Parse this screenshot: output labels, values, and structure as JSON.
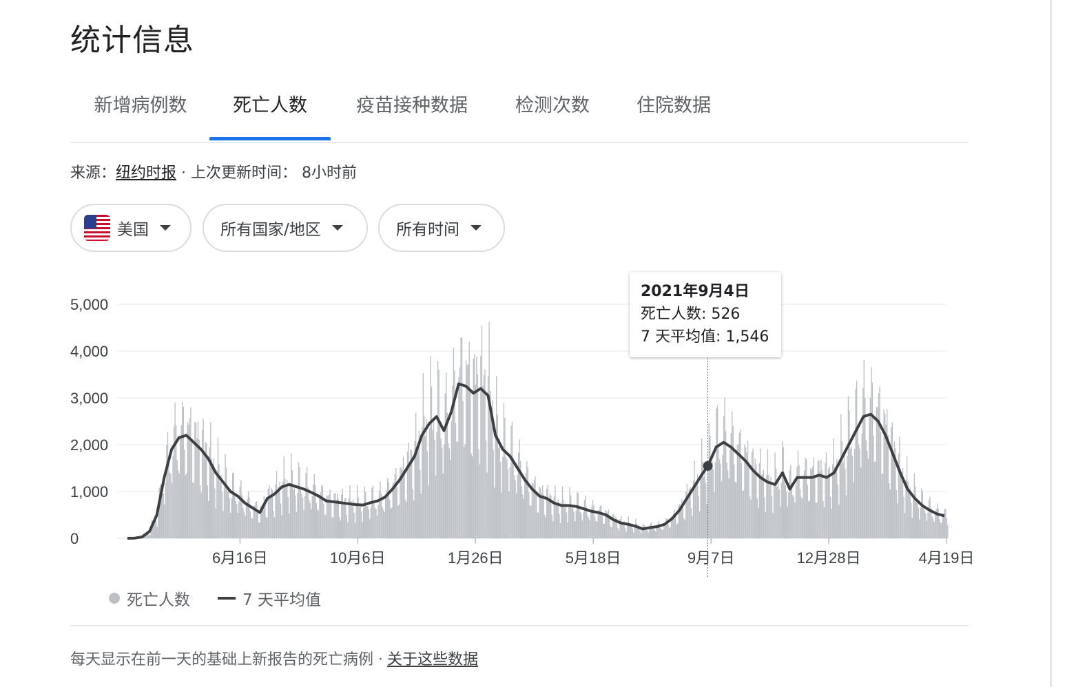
{
  "page": {
    "title": "统计信息"
  },
  "tabs": [
    {
      "label": "新增病例数",
      "active": false
    },
    {
      "label": "死亡人数",
      "active": true
    },
    {
      "label": "疫苗接种数据",
      "active": false
    },
    {
      "label": "检测次数",
      "active": false
    },
    {
      "label": "住院数据",
      "active": false
    }
  ],
  "source": {
    "prefix": "来源：",
    "name": "纽约时报",
    "sep": " · 上次更新时间： ",
    "updated": "8小时前"
  },
  "filters": {
    "country": "美国",
    "region": "所有国家/地区",
    "time": "所有时间"
  },
  "chart_data": {
    "type": "bar",
    "combo_line": true,
    "y_ticks": [
      "5,000",
      "4,000",
      "3,000",
      "2,000",
      "1,000",
      "0"
    ],
    "ylim": [
      0,
      5000
    ],
    "x_ticks": [
      "6月16日",
      "10月6日",
      "1月26日",
      "5月18日",
      "9月7日",
      "12月28日",
      "4月19日"
    ],
    "grid": true,
    "colors": {
      "bars": "#bdc1c6",
      "line": "#3c4043",
      "accent": "#1a73e8"
    },
    "series": [
      {
        "name": "死亡人数",
        "kind": "daily_bars"
      },
      {
        "name": "7 天平均值",
        "kind": "line"
      }
    ],
    "weekly_avg": [
      {
        "x": "2020-03-01",
        "y": 0
      },
      {
        "x": "2020-03-08",
        "y": 5
      },
      {
        "x": "2020-03-15",
        "y": 30
      },
      {
        "x": "2020-03-22",
        "y": 150
      },
      {
        "x": "2020-03-29",
        "y": 500
      },
      {
        "x": "2020-04-05",
        "y": 1300
      },
      {
        "x": "2020-04-12",
        "y": 1900
      },
      {
        "x": "2020-04-19",
        "y": 2150
      },
      {
        "x": "2020-04-26",
        "y": 2200
      },
      {
        "x": "2020-05-03",
        "y": 2050
      },
      {
        "x": "2020-05-10",
        "y": 1900
      },
      {
        "x": "2020-05-17",
        "y": 1700
      },
      {
        "x": "2020-05-24",
        "y": 1400
      },
      {
        "x": "2020-05-31",
        "y": 1200
      },
      {
        "x": "2020-06-07",
        "y": 1000
      },
      {
        "x": "2020-06-14",
        "y": 900
      },
      {
        "x": "2020-06-21",
        "y": 750
      },
      {
        "x": "2020-06-28",
        "y": 650
      },
      {
        "x": "2020-07-05",
        "y": 550
      },
      {
        "x": "2020-07-12",
        "y": 850
      },
      {
        "x": "2020-07-19",
        "y": 950
      },
      {
        "x": "2020-07-26",
        "y": 1100
      },
      {
        "x": "2020-08-02",
        "y": 1150
      },
      {
        "x": "2020-08-09",
        "y": 1100
      },
      {
        "x": "2020-08-16",
        "y": 1050
      },
      {
        "x": "2020-08-23",
        "y": 980
      },
      {
        "x": "2020-08-30",
        "y": 900
      },
      {
        "x": "2020-09-06",
        "y": 800
      },
      {
        "x": "2020-09-13",
        "y": 780
      },
      {
        "x": "2020-09-20",
        "y": 760
      },
      {
        "x": "2020-09-27",
        "y": 740
      },
      {
        "x": "2020-10-04",
        "y": 720
      },
      {
        "x": "2020-10-11",
        "y": 710
      },
      {
        "x": "2020-10-18",
        "y": 760
      },
      {
        "x": "2020-10-25",
        "y": 800
      },
      {
        "x": "2020-11-01",
        "y": 880
      },
      {
        "x": "2020-11-08",
        "y": 1050
      },
      {
        "x": "2020-11-15",
        "y": 1250
      },
      {
        "x": "2020-11-22",
        "y": 1500
      },
      {
        "x": "2020-11-29",
        "y": 1750
      },
      {
        "x": "2020-12-06",
        "y": 2200
      },
      {
        "x": "2020-12-13",
        "y": 2450
      },
      {
        "x": "2020-12-20",
        "y": 2600
      },
      {
        "x": "2020-12-27",
        "y": 2300
      },
      {
        "x": "2021-01-03",
        "y": 2700
      },
      {
        "x": "2021-01-10",
        "y": 3300
      },
      {
        "x": "2021-01-17",
        "y": 3250
      },
      {
        "x": "2021-01-24",
        "y": 3100
      },
      {
        "x": "2021-01-31",
        "y": 3200
      },
      {
        "x": "2021-02-07",
        "y": 3050
      },
      {
        "x": "2021-02-14",
        "y": 2200
      },
      {
        "x": "2021-02-21",
        "y": 1900
      },
      {
        "x": "2021-02-28",
        "y": 1750
      },
      {
        "x": "2021-03-07",
        "y": 1500
      },
      {
        "x": "2021-03-14",
        "y": 1250
      },
      {
        "x": "2021-03-21",
        "y": 1050
      },
      {
        "x": "2021-03-28",
        "y": 900
      },
      {
        "x": "2021-04-04",
        "y": 850
      },
      {
        "x": "2021-04-11",
        "y": 750
      },
      {
        "x": "2021-04-18",
        "y": 700
      },
      {
        "x": "2021-04-25",
        "y": 700
      },
      {
        "x": "2021-05-02",
        "y": 680
      },
      {
        "x": "2021-05-09",
        "y": 630
      },
      {
        "x": "2021-05-16",
        "y": 580
      },
      {
        "x": "2021-05-23",
        "y": 550
      },
      {
        "x": "2021-05-30",
        "y": 500
      },
      {
        "x": "2021-06-06",
        "y": 400
      },
      {
        "x": "2021-06-13",
        "y": 330
      },
      {
        "x": "2021-06-20",
        "y": 300
      },
      {
        "x": "2021-06-27",
        "y": 260
      },
      {
        "x": "2021-07-04",
        "y": 200
      },
      {
        "x": "2021-07-11",
        "y": 230
      },
      {
        "x": "2021-07-18",
        "y": 250
      },
      {
        "x": "2021-07-25",
        "y": 300
      },
      {
        "x": "2021-08-01",
        "y": 420
      },
      {
        "x": "2021-08-08",
        "y": 600
      },
      {
        "x": "2021-08-15",
        "y": 850
      },
      {
        "x": "2021-08-22",
        "y": 1100
      },
      {
        "x": "2021-08-29",
        "y": 1350
      },
      {
        "x": "2021-09-04",
        "y": 1546
      },
      {
        "x": "2021-09-12",
        "y": 1950
      },
      {
        "x": "2021-09-19",
        "y": 2050
      },
      {
        "x": "2021-09-26",
        "y": 1950
      },
      {
        "x": "2021-10-03",
        "y": 1800
      },
      {
        "x": "2021-10-10",
        "y": 1650
      },
      {
        "x": "2021-10-17",
        "y": 1450
      },
      {
        "x": "2021-10-24",
        "y": 1300
      },
      {
        "x": "2021-10-31",
        "y": 1200
      },
      {
        "x": "2021-11-07",
        "y": 1150
      },
      {
        "x": "2021-11-14",
        "y": 1400
      },
      {
        "x": "2021-11-21",
        "y": 1050
      },
      {
        "x": "2021-11-28",
        "y": 1300
      },
      {
        "x": "2021-12-05",
        "y": 1300
      },
      {
        "x": "2021-12-12",
        "y": 1300
      },
      {
        "x": "2021-12-19",
        "y": 1350
      },
      {
        "x": "2021-12-26",
        "y": 1300
      },
      {
        "x": "2022-01-02",
        "y": 1400
      },
      {
        "x": "2022-01-09",
        "y": 1700
      },
      {
        "x": "2022-01-16",
        "y": 2000
      },
      {
        "x": "2022-01-23",
        "y": 2300
      },
      {
        "x": "2022-01-30",
        "y": 2600
      },
      {
        "x": "2022-02-06",
        "y": 2650
      },
      {
        "x": "2022-02-13",
        "y": 2500
      },
      {
        "x": "2022-02-20",
        "y": 2200
      },
      {
        "x": "2022-02-27",
        "y": 1800
      },
      {
        "x": "2022-03-06",
        "y": 1400
      },
      {
        "x": "2022-03-13",
        "y": 1050
      },
      {
        "x": "2022-03-20",
        "y": 850
      },
      {
        "x": "2022-03-27",
        "y": 700
      },
      {
        "x": "2022-04-03",
        "y": 600
      },
      {
        "x": "2022-04-10",
        "y": 520
      },
      {
        "x": "2022-04-17",
        "y": 480
      }
    ],
    "tooltip": {
      "date": "2021年9月4日",
      "deaths_label": "死亡人数: 526",
      "avg_label": "7 天平均值: 1,546"
    }
  },
  "legend": {
    "bars": "死亡人数",
    "line": "7 天平均值"
  },
  "footer": {
    "note": "每天显示在前一天的基础上新报告的死亡病例 ·",
    "link": "关于这些数据"
  }
}
